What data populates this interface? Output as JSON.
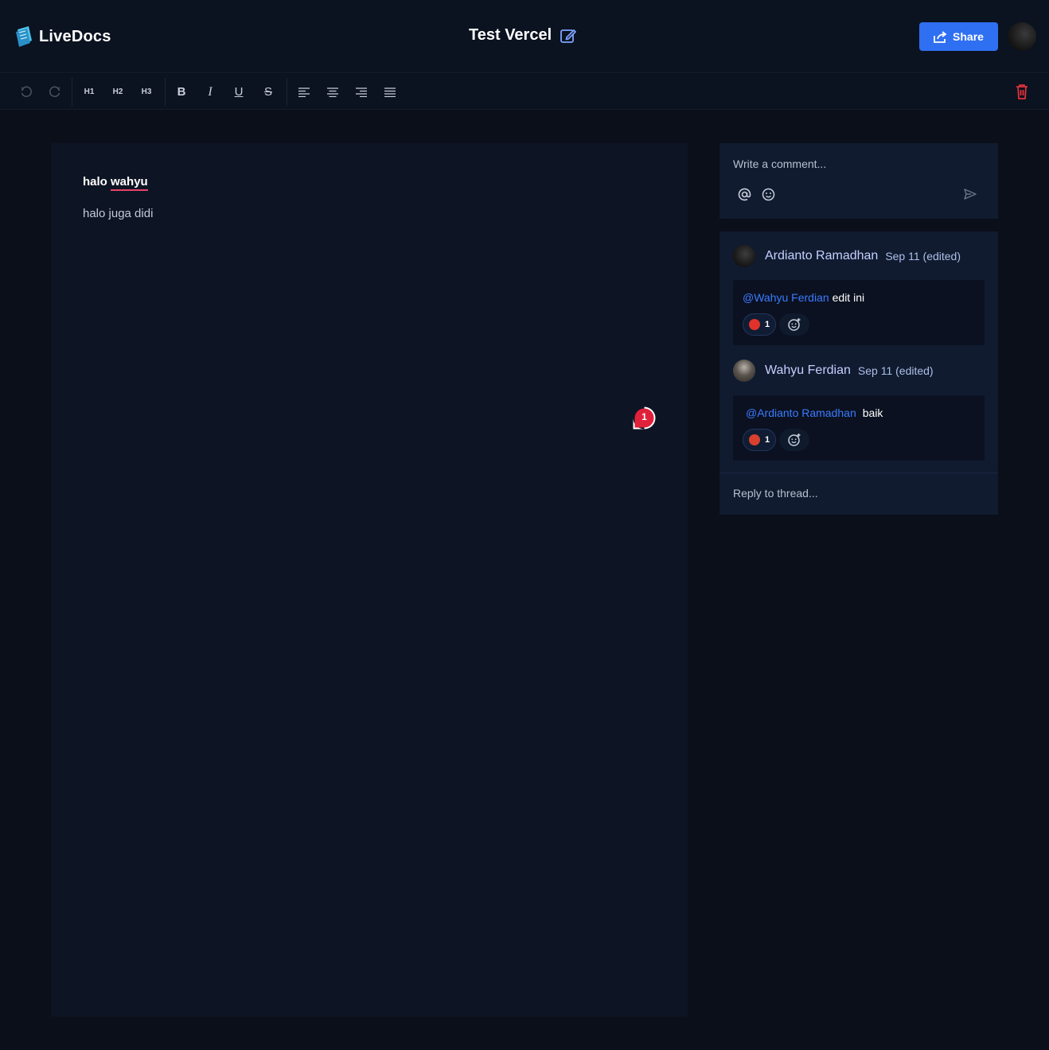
{
  "app": {
    "name": "LiveDocs"
  },
  "document": {
    "title": "Test Vercel"
  },
  "header": {
    "share_label": "Share"
  },
  "toolbar": {
    "h1": "H1",
    "h2": "H2",
    "h3": "H3",
    "bold": "B",
    "italic": "I",
    "underline": "U",
    "strike": "S"
  },
  "editor": {
    "line1_prefix": "halo ",
    "line1_highlight": "wahyu",
    "line2": "halo juga didi",
    "thread_count": "1"
  },
  "composer": {
    "placeholder": "Write a comment..."
  },
  "thread": {
    "comments": [
      {
        "author": "Ardianto Ramadhan",
        "date": "Sep 11 (edited)",
        "mention": "@Wahyu Ferdian",
        "text": "edit ini",
        "reaction_count": "1"
      },
      {
        "author": "Wahyu Ferdian",
        "date": "Sep 11 (edited)",
        "mention": "@Ardianto Ramadhan",
        "text": "baik",
        "reaction_count": "1"
      }
    ],
    "reply_placeholder": "Reply to thread..."
  },
  "colors": {
    "accent": "#2f6ff1",
    "danger": "#e0323b",
    "mention": "#3a7bff",
    "background": "#0a0f1a",
    "panel": "#101b30"
  }
}
